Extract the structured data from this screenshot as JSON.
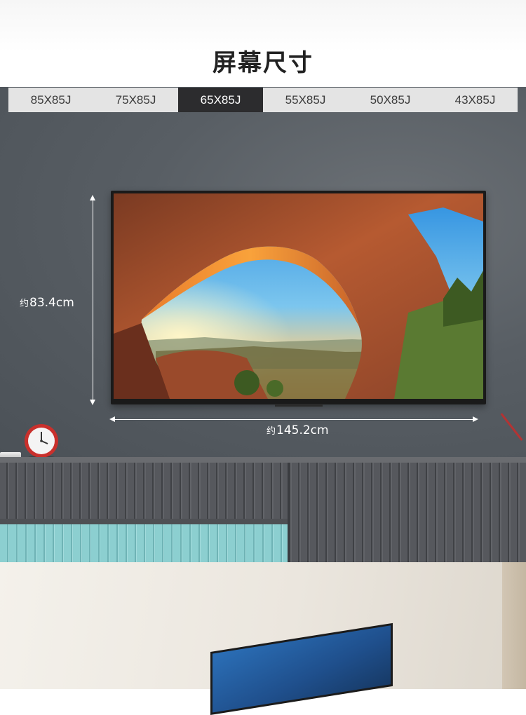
{
  "page": {
    "title": "屏幕尺寸"
  },
  "size_tabs": {
    "items": [
      {
        "label": "85X85J",
        "active": false
      },
      {
        "label": "75X85J",
        "active": false
      },
      {
        "label": "65X85J",
        "active": true
      },
      {
        "label": "55X85J",
        "active": false
      },
      {
        "label": "50X85J",
        "active": false
      },
      {
        "label": "43X85J",
        "active": false
      }
    ]
  },
  "dimensions": {
    "height": {
      "prefix": "约",
      "value": "83.4cm"
    },
    "width": {
      "prefix": "约",
      "value": "145.2cm"
    }
  },
  "colors": {
    "active_tab_bg": "#2c2c2e",
    "tab_bar_bg": "#e4e4e4",
    "wall": "#585e64"
  }
}
